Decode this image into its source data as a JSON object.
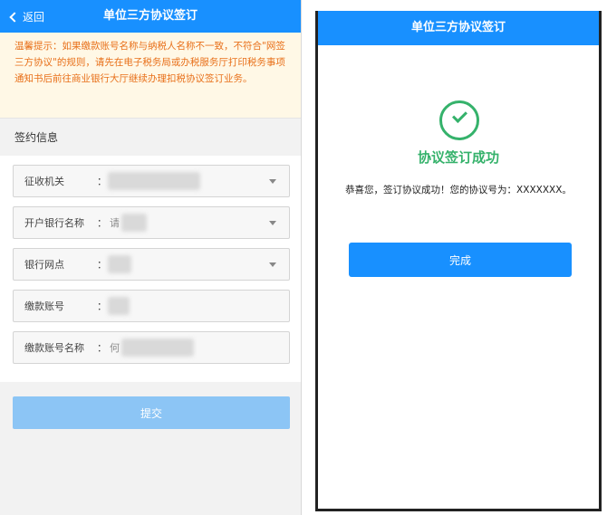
{
  "left_screen": {
    "back_label": "返回",
    "title": "单位三方协议签订",
    "tip": "温馨提示：如果缴款账号名称与纳税人名称不一致，不符合\"网签三方协议\"的规则，请先在电子税务局或办税服务厅打印税务事项通知书后前往商业银行大厅继续办理扣税协议签订业务。",
    "section_title": "签约信息",
    "fields": [
      {
        "label": "征收机关",
        "prefix": "",
        "dropdown": true
      },
      {
        "label": "开户银行名称",
        "prefix": "请",
        "dropdown": true
      },
      {
        "label": "银行网点",
        "prefix": "",
        "dropdown": true
      },
      {
        "label": "缴款账号",
        "prefix": "",
        "dropdown": false
      },
      {
        "label": "缴款账号名称",
        "prefix": "何",
        "dropdown": false
      }
    ],
    "colon": "：",
    "submit_label": "提交"
  },
  "right_screen": {
    "title": "单位三方协议签订",
    "success_title": "协议签订成功",
    "success_message": "恭喜您，签订协议成功！您的协议号为：XXXXXXX。",
    "done_label": "完成"
  },
  "colors": {
    "primary": "#1890ff",
    "submit_disabled": "#8cc5f5",
    "success": "#35b26b",
    "warning_text": "#e8701a",
    "warning_bg": "#fff8e6"
  },
  "icons": [
    "chevron-left-icon",
    "caret-down-icon",
    "success-check-icon"
  ]
}
